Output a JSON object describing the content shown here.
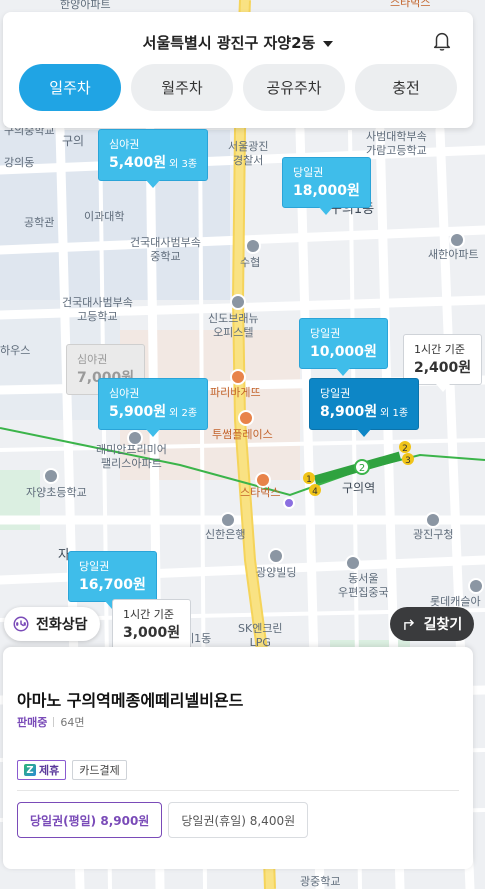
{
  "header": {
    "location": "서울특별시 광진구 자양2동",
    "icons": {
      "dropdown": "chevron-down-icon",
      "notification": "bell-icon"
    },
    "tabs": [
      {
        "label": "일주차",
        "active": true
      },
      {
        "label": "월주차",
        "active": false
      },
      {
        "label": "공유주차",
        "active": false
      },
      {
        "label": "충전",
        "active": false
      }
    ]
  },
  "map": {
    "labels": {
      "top_left_cut": "한양아파트",
      "top_right_cut": "스타벅스",
      "univ_cut": "구의중학교",
      "gu": "구의",
      "gangui": "강의동",
      "police": "서울광진\n경찰서",
      "sahbum": "사범대학부속\n가람고등학교",
      "gonghak": "공학관",
      "iigong": "이과대학",
      "gunkuk_mid": "건국대사범부속\n중학교",
      "suhyup": "수협",
      "guui1": "구의1동",
      "saehan": "새한아파트",
      "gunkuk_high": "건국대사범부속\n고등학교",
      "shindo": "신도브래뉴\n오피스텔",
      "house": "하우스",
      "paris": "파리바게뜨",
      "twosome": "투썸플레이스",
      "raemian": "래미안프리미어\n팰리스아파트",
      "starbucks": "스타벅스",
      "guui_station": "구의역",
      "jayang": "자양초등학교",
      "shinhan": "신한은행",
      "gwangjin_office": "광진구청",
      "gwangyang": "광양빌딩",
      "dongseoul": "동서울\n우편집중국",
      "lotte": "롯데캐슬아",
      "sk": "SK엔크린\nLPG",
      "jayang_cut": "자",
      "je1": "제1동",
      "gwangjin_cut": "광진",
      "yangjin": "광중학교"
    },
    "station_badges": [
      "1",
      "4",
      "2",
      "2",
      "3"
    ]
  },
  "markers": [
    {
      "type": "심야권",
      "price": "5,400원",
      "extra": "외 3종",
      "style": "light"
    },
    {
      "type": "당일권",
      "price": "18,000원",
      "extra": "",
      "style": "light"
    },
    {
      "type": "당일권",
      "price": "10,000원",
      "extra": "",
      "style": "light"
    },
    {
      "type": "1시간 기준",
      "price": "2,400원",
      "extra": "",
      "style": "white"
    },
    {
      "type": "심야권",
      "price": "7,000원",
      "extra": "",
      "style": "grey"
    },
    {
      "type": "심야권",
      "price": "5,900원",
      "extra": "외 2종",
      "style": "light"
    },
    {
      "type": "당일권",
      "price": "8,900원",
      "extra": "외 1종",
      "style": "dark"
    },
    {
      "type": "당일권",
      "price": "16,700원",
      "extra": "",
      "style": "light"
    },
    {
      "type": "1시간 기준",
      "price": "3,000원",
      "extra": "",
      "style": "white"
    }
  ],
  "buttons": {
    "consult": "전화상담",
    "route": "길찾기"
  },
  "card": {
    "title": "아마노 구의역메종에떼리넬비욘드",
    "status": "판매중",
    "spaces": "64면",
    "badges": [
      "제휴",
      "카드결제"
    ],
    "tickets": [
      {
        "label": "당일권(평일) 8,900원",
        "selected": true
      },
      {
        "label": "당일권(휴일) 8,400원",
        "selected": false
      }
    ]
  }
}
